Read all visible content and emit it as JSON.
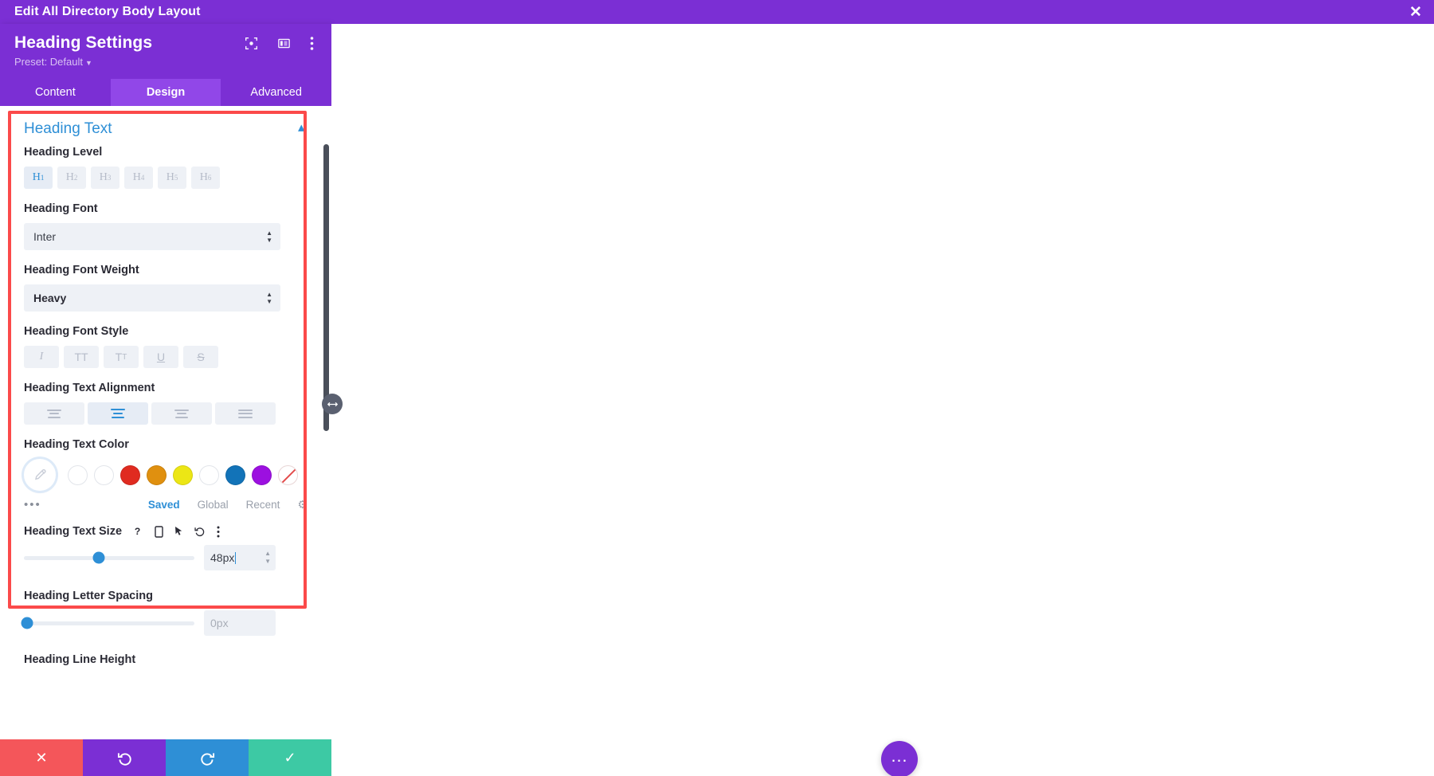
{
  "topbar": {
    "title": "Edit All Directory Body Layout",
    "close_icon": "close-icon"
  },
  "panel": {
    "title": "Heading Settings",
    "preset_label": "Preset: Default",
    "head_icons": [
      "target-icon",
      "layout-columns-icon",
      "kebab-menu-icon"
    ],
    "tabs": [
      {
        "label": "Content",
        "active": false
      },
      {
        "label": "Design",
        "active": true
      },
      {
        "label": "Advanced",
        "active": false
      }
    ]
  },
  "section": {
    "title": "Heading Text",
    "collapse_icon": "chevron-up-icon",
    "kebab_icon": "kebab-menu-icon"
  },
  "heading_level": {
    "label": "Heading Level",
    "options": [
      {
        "tag": "H",
        "sub": "1",
        "active": true
      },
      {
        "tag": "H",
        "sub": "2",
        "active": false
      },
      {
        "tag": "H",
        "sub": "3",
        "active": false
      },
      {
        "tag": "H",
        "sub": "4",
        "active": false
      },
      {
        "tag": "H",
        "sub": "5",
        "active": false
      },
      {
        "tag": "H",
        "sub": "6",
        "active": false
      }
    ]
  },
  "heading_font": {
    "label": "Heading Font",
    "value": "Inter"
  },
  "heading_font_weight": {
    "label": "Heading Font Weight",
    "value": "Heavy"
  },
  "heading_font_style": {
    "label": "Heading Font Style",
    "options": [
      {
        "glyph": "I",
        "name": "italic-button",
        "active": false
      },
      {
        "glyph": "TT",
        "name": "uppercase-button",
        "active": false
      },
      {
        "glyph": "TT",
        "name": "smallcaps-button",
        "active": false
      },
      {
        "glyph": "U",
        "name": "underline-button",
        "active": false
      },
      {
        "glyph": "S",
        "name": "strikethrough-button",
        "active": false
      }
    ]
  },
  "heading_text_alignment": {
    "label": "Heading Text Alignment",
    "options": [
      {
        "name": "align-left-button",
        "active": false
      },
      {
        "name": "align-center-button",
        "active": true
      },
      {
        "name": "align-right-button",
        "active": false
      },
      {
        "name": "align-justify-button",
        "active": false
      }
    ]
  },
  "heading_text_color": {
    "label": "Heading Text Color",
    "picker_icon": "eyedropper-icon",
    "swatches": [
      {
        "color": "#ffffff",
        "type": "empty"
      },
      {
        "color": "#ffffff",
        "type": "empty"
      },
      {
        "color": "#e02b20",
        "type": "solid"
      },
      {
        "color": "#e0900f",
        "type": "solid"
      },
      {
        "color": "#ece615",
        "type": "solid"
      },
      {
        "color": "#ffffff",
        "type": "empty"
      },
      {
        "color": "#1273b8",
        "type": "solid"
      },
      {
        "color": "#9c10e0",
        "type": "solid"
      },
      {
        "color": "#ffffff",
        "type": "none"
      }
    ],
    "more_icon": "more-dots-icon",
    "tabs": [
      {
        "label": "Saved",
        "active": true
      },
      {
        "label": "Global",
        "active": false
      },
      {
        "label": "Recent",
        "active": false
      }
    ],
    "settings_icon": "gear-icon"
  },
  "heading_text_size": {
    "label": "Heading Text Size",
    "icons": [
      "help-icon",
      "mobile-device-icon",
      "cursor-hover-icon",
      "reset-icon",
      "kebab-menu-icon"
    ],
    "value": "48px",
    "slider_percent": 44
  },
  "heading_letter_spacing": {
    "label": "Heading Letter Spacing",
    "placeholder": "0px",
    "slider_percent": 2
  },
  "heading_line_height": {
    "label": "Heading Line Height"
  },
  "actionbar": {
    "buttons": [
      {
        "name": "discard-button",
        "glyph": "✕",
        "color": "#f4565a"
      },
      {
        "name": "undo-button",
        "glyph": "↺",
        "color": "#7b2fd4"
      },
      {
        "name": "redo-button",
        "glyph": "↻",
        "color": "#2e8fd6"
      },
      {
        "name": "save-button",
        "glyph": "✓",
        "color": "#3dc9a4"
      }
    ]
  },
  "canvas": {
    "fab_icon": "more-options-fab",
    "fab_glyph": "…"
  },
  "drag_handle": {
    "glyph": "↔"
  },
  "colors": {
    "purple": "#7b2fd4",
    "purple_light": "#9147e8",
    "blue": "#2e8fd6",
    "highlight_red": "#fb4a4a",
    "teal": "#3dc9a4"
  }
}
